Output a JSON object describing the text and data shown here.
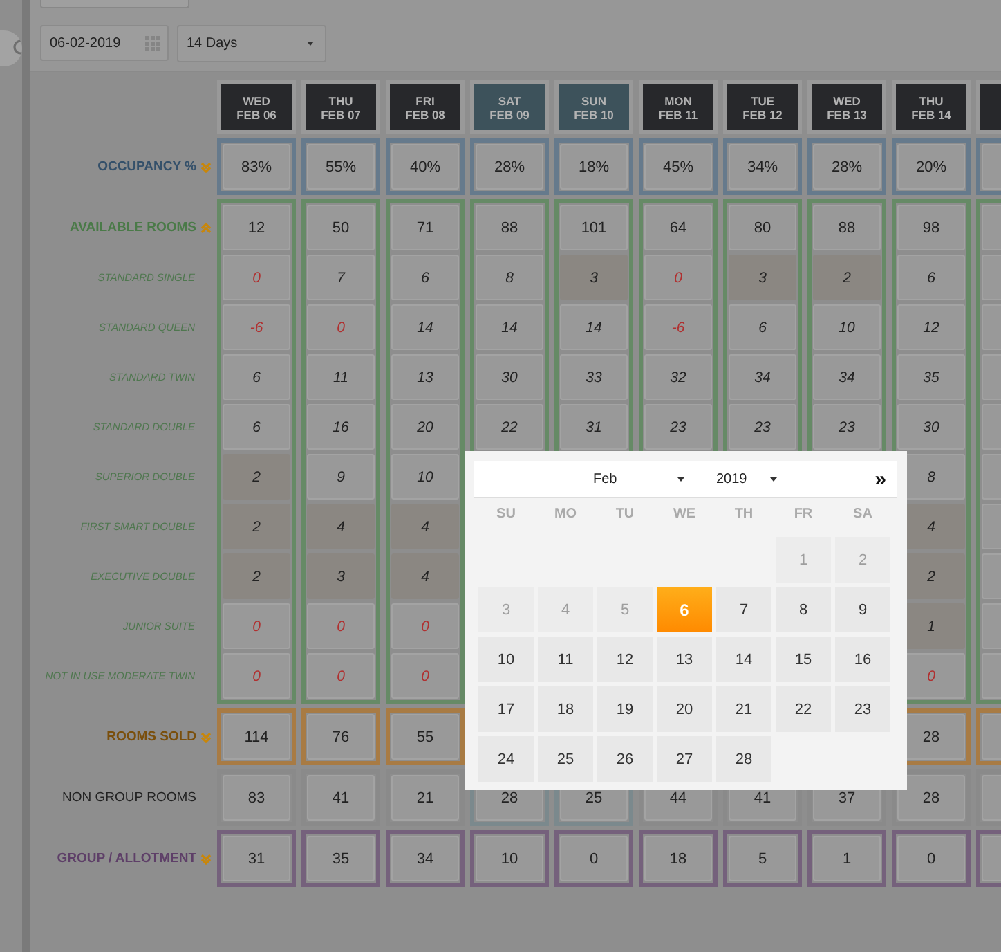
{
  "toolbar": {
    "date_field": {
      "value": "06-02-2019"
    },
    "range_select": {
      "value": "14 Days"
    }
  },
  "columns": [
    {
      "weekday": "WED",
      "date": "FEB 06",
      "weekend": false
    },
    {
      "weekday": "THU",
      "date": "FEB 07",
      "weekend": false
    },
    {
      "weekday": "FRI",
      "date": "FEB 08",
      "weekend": false
    },
    {
      "weekday": "SAT",
      "date": "FEB 09",
      "weekend": true
    },
    {
      "weekday": "SUN",
      "date": "FEB 10",
      "weekend": true
    },
    {
      "weekday": "MON",
      "date": "FEB 11",
      "weekend": false
    },
    {
      "weekday": "TUE",
      "date": "FEB 12",
      "weekend": false
    },
    {
      "weekday": "WED",
      "date": "FEB 13",
      "weekend": false
    },
    {
      "weekday": "THU",
      "date": "FEB 14",
      "weekend": false
    }
  ],
  "groups": [
    {
      "kind": "occupancy",
      "rows": [
        {
          "label": "OCCUPANCY %",
          "kind": "total",
          "expanded": false,
          "cells": [
            {
              "value": "83%",
              "alert": false,
              "shaded": false
            },
            {
              "value": "55%",
              "alert": false,
              "shaded": false
            },
            {
              "value": "40%",
              "alert": false,
              "shaded": false
            },
            {
              "value": "28%",
              "alert": false,
              "shaded": false
            },
            {
              "value": "18%",
              "alert": false,
              "shaded": false
            },
            {
              "value": "45%",
              "alert": false,
              "shaded": false
            },
            {
              "value": "34%",
              "alert": false,
              "shaded": false
            },
            {
              "value": "28%",
              "alert": false,
              "shaded": false
            },
            {
              "value": "20%",
              "alert": false,
              "shaded": false
            }
          ]
        }
      ]
    },
    {
      "kind": "available",
      "rows": [
        {
          "label": "AVAILABLE ROOMS",
          "kind": "total",
          "expanded": true,
          "cells": [
            {
              "value": "12",
              "alert": false,
              "shaded": false
            },
            {
              "value": "50",
              "alert": false,
              "shaded": false
            },
            {
              "value": "71",
              "alert": false,
              "shaded": false
            },
            {
              "value": "88",
              "alert": false,
              "shaded": false
            },
            {
              "value": "101",
              "alert": false,
              "shaded": false
            },
            {
              "value": "64",
              "alert": false,
              "shaded": false
            },
            {
              "value": "80",
              "alert": false,
              "shaded": false
            },
            {
              "value": "88",
              "alert": false,
              "shaded": false
            },
            {
              "value": "98",
              "alert": false,
              "shaded": false
            }
          ]
        },
        {
          "label": "STANDARD SINGLE",
          "kind": "room_type",
          "cells": [
            {
              "value": "0",
              "alert": true,
              "shaded": false
            },
            {
              "value": "7",
              "alert": false,
              "shaded": false
            },
            {
              "value": "6",
              "alert": false,
              "shaded": false
            },
            {
              "value": "8",
              "alert": false,
              "shaded": false
            },
            {
              "value": "3",
              "alert": false,
              "shaded": true
            },
            {
              "value": "0",
              "alert": true,
              "shaded": false
            },
            {
              "value": "3",
              "alert": false,
              "shaded": true
            },
            {
              "value": "2",
              "alert": false,
              "shaded": true
            },
            {
              "value": "6",
              "alert": false,
              "shaded": false
            }
          ]
        },
        {
          "label": "STANDARD QUEEN",
          "kind": "room_type",
          "cells": [
            {
              "value": "-6",
              "alert": true,
              "shaded": false
            },
            {
              "value": "0",
              "alert": true,
              "shaded": false
            },
            {
              "value": "14",
              "alert": false,
              "shaded": false
            },
            {
              "value": "14",
              "alert": false,
              "shaded": false
            },
            {
              "value": "14",
              "alert": false,
              "shaded": false
            },
            {
              "value": "-6",
              "alert": true,
              "shaded": false
            },
            {
              "value": "6",
              "alert": false,
              "shaded": false
            },
            {
              "value": "10",
              "alert": false,
              "shaded": false
            },
            {
              "value": "12",
              "alert": false,
              "shaded": false
            }
          ]
        },
        {
          "label": "STANDARD TWIN",
          "kind": "room_type",
          "cells": [
            {
              "value": "6",
              "alert": false,
              "shaded": false
            },
            {
              "value": "11",
              "alert": false,
              "shaded": false
            },
            {
              "value": "13",
              "alert": false,
              "shaded": false
            },
            {
              "value": "30",
              "alert": false,
              "shaded": false
            },
            {
              "value": "33",
              "alert": false,
              "shaded": false
            },
            {
              "value": "32",
              "alert": false,
              "shaded": false
            },
            {
              "value": "34",
              "alert": false,
              "shaded": false
            },
            {
              "value": "34",
              "alert": false,
              "shaded": false
            },
            {
              "value": "35",
              "alert": false,
              "shaded": false
            }
          ]
        },
        {
          "label": "STANDARD DOUBLE",
          "kind": "room_type",
          "cells": [
            {
              "value": "6",
              "alert": false,
              "shaded": false
            },
            {
              "value": "16",
              "alert": false,
              "shaded": false
            },
            {
              "value": "20",
              "alert": false,
              "shaded": false
            },
            {
              "value": "22",
              "alert": false,
              "shaded": false
            },
            {
              "value": "31",
              "alert": false,
              "shaded": false
            },
            {
              "value": "23",
              "alert": false,
              "shaded": false
            },
            {
              "value": "23",
              "alert": false,
              "shaded": false
            },
            {
              "value": "23",
              "alert": false,
              "shaded": false
            },
            {
              "value": "30",
              "alert": false,
              "shaded": false
            }
          ]
        },
        {
          "label": "SUPERIOR DOUBLE",
          "kind": "room_type",
          "cells": [
            {
              "value": "2",
              "alert": false,
              "shaded": true
            },
            {
              "value": "9",
              "alert": false,
              "shaded": false
            },
            {
              "value": "10",
              "alert": false,
              "shaded": false
            },
            null,
            null,
            null,
            null,
            null,
            {
              "value": "8",
              "alert": false,
              "shaded": false
            }
          ]
        },
        {
          "label": "FIRST SMART DOUBLE",
          "kind": "room_type",
          "cells": [
            {
              "value": "2",
              "alert": false,
              "shaded": true
            },
            {
              "value": "4",
              "alert": false,
              "shaded": true
            },
            {
              "value": "4",
              "alert": false,
              "shaded": true
            },
            null,
            null,
            null,
            null,
            null,
            {
              "value": "4",
              "alert": false,
              "shaded": true
            }
          ]
        },
        {
          "label": "EXECUTIVE DOUBLE",
          "kind": "room_type",
          "cells": [
            {
              "value": "2",
              "alert": false,
              "shaded": true
            },
            {
              "value": "3",
              "alert": false,
              "shaded": true
            },
            {
              "value": "4",
              "alert": false,
              "shaded": true
            },
            null,
            null,
            null,
            null,
            null,
            {
              "value": "2",
              "alert": false,
              "shaded": true
            }
          ]
        },
        {
          "label": "JUNIOR SUITE",
          "kind": "room_type",
          "cells": [
            {
              "value": "0",
              "alert": true,
              "shaded": false
            },
            {
              "value": "0",
              "alert": true,
              "shaded": false
            },
            {
              "value": "0",
              "alert": true,
              "shaded": false
            },
            null,
            null,
            null,
            null,
            null,
            {
              "value": "1",
              "alert": false,
              "shaded": true
            }
          ]
        },
        {
          "label": "NOT IN USE MODERATE TWIN",
          "kind": "room_type",
          "cells": [
            {
              "value": "0",
              "alert": true,
              "shaded": false
            },
            {
              "value": "0",
              "alert": true,
              "shaded": false
            },
            {
              "value": "0",
              "alert": true,
              "shaded": false
            },
            null,
            null,
            null,
            null,
            null,
            {
              "value": "0",
              "alert": true,
              "shaded": false
            }
          ]
        }
      ]
    },
    {
      "kind": "sold",
      "rows": [
        {
          "label": "ROOMS SOLD",
          "kind": "total",
          "expanded": false,
          "cells": [
            {
              "value": "114",
              "alert": false,
              "shaded": false
            },
            {
              "value": "76",
              "alert": false,
              "shaded": false
            },
            {
              "value": "55",
              "alert": false,
              "shaded": false
            },
            null,
            null,
            null,
            null,
            null,
            {
              "value": "28",
              "alert": false,
              "shaded": false
            }
          ]
        }
      ]
    },
    {
      "kind": "non_group",
      "rows": [
        {
          "label": "NON GROUP ROOMS",
          "kind": "total",
          "cells": [
            {
              "value": "83",
              "alert": false,
              "shaded": false
            },
            {
              "value": "41",
              "alert": false,
              "shaded": false
            },
            {
              "value": "21",
              "alert": false,
              "shaded": false
            },
            {
              "value": "28",
              "alert": false,
              "shaded": false
            },
            {
              "value": "25",
              "alert": false,
              "shaded": false
            },
            {
              "value": "44",
              "alert": false,
              "shaded": false
            },
            {
              "value": "41",
              "alert": false,
              "shaded": false
            },
            {
              "value": "37",
              "alert": false,
              "shaded": false
            },
            {
              "value": "28",
              "alert": false,
              "shaded": false
            }
          ]
        }
      ]
    },
    {
      "kind": "group",
      "rows": [
        {
          "label": "GROUP / ALLOTMENT",
          "kind": "total",
          "expanded": false,
          "cells": [
            {
              "value": "31",
              "alert": false,
              "shaded": false
            },
            {
              "value": "35",
              "alert": false,
              "shaded": false
            },
            {
              "value": "34",
              "alert": false,
              "shaded": false
            },
            {
              "value": "10",
              "alert": false,
              "shaded": false
            },
            {
              "value": "0",
              "alert": false,
              "shaded": false
            },
            {
              "value": "18",
              "alert": false,
              "shaded": false
            },
            {
              "value": "5",
              "alert": false,
              "shaded": false
            },
            {
              "value": "1",
              "alert": false,
              "shaded": false
            },
            {
              "value": "0",
              "alert": false,
              "shaded": false
            }
          ]
        }
      ]
    }
  ],
  "calendar": {
    "month": "Feb",
    "year": "2019",
    "next": "»",
    "weekdays": [
      "SU",
      "MO",
      "TU",
      "WE",
      "TH",
      "FR",
      "SA"
    ],
    "weeks": [
      [
        {
          "kind": "blank"
        },
        {
          "kind": "blank"
        },
        {
          "kind": "blank"
        },
        {
          "kind": "blank"
        },
        {
          "kind": "blank"
        },
        {
          "day": "1",
          "disabled": true,
          "selected": false
        },
        {
          "day": "2",
          "disabled": true,
          "selected": false
        }
      ],
      [
        {
          "day": "3",
          "disabled": true,
          "selected": false
        },
        {
          "day": "4",
          "disabled": true,
          "selected": false
        },
        {
          "day": "5",
          "disabled": true,
          "selected": false
        },
        {
          "day": "6",
          "disabled": false,
          "selected": true
        },
        {
          "day": "7",
          "disabled": false,
          "selected": false
        },
        {
          "day": "8",
          "disabled": false,
          "selected": false
        },
        {
          "day": "9",
          "disabled": false,
          "selected": false
        }
      ],
      [
        {
          "day": "10",
          "disabled": false,
          "selected": false
        },
        {
          "day": "11",
          "disabled": false,
          "selected": false
        },
        {
          "day": "12",
          "disabled": false,
          "selected": false
        },
        {
          "day": "13",
          "disabled": false,
          "selected": false
        },
        {
          "day": "14",
          "disabled": false,
          "selected": false
        },
        {
          "day": "15",
          "disabled": false,
          "selected": false
        },
        {
          "day": "16",
          "disabled": false,
          "selected": false
        }
      ],
      [
        {
          "day": "17",
          "disabled": false,
          "selected": false
        },
        {
          "day": "18",
          "disabled": false,
          "selected": false
        },
        {
          "day": "19",
          "disabled": false,
          "selected": false
        },
        {
          "day": "20",
          "disabled": false,
          "selected": false
        },
        {
          "day": "21",
          "disabled": false,
          "selected": false
        },
        {
          "day": "22",
          "disabled": false,
          "selected": false
        },
        {
          "day": "23",
          "disabled": false,
          "selected": false
        }
      ],
      [
        {
          "day": "24",
          "disabled": false,
          "selected": false
        },
        {
          "day": "25",
          "disabled": false,
          "selected": false
        },
        {
          "day": "26",
          "disabled": false,
          "selected": false
        },
        {
          "day": "27",
          "disabled": false,
          "selected": false
        },
        {
          "day": "28",
          "disabled": false,
          "selected": false
        },
        {
          "kind": "blank"
        },
        {
          "kind": "blank"
        }
      ]
    ]
  }
}
